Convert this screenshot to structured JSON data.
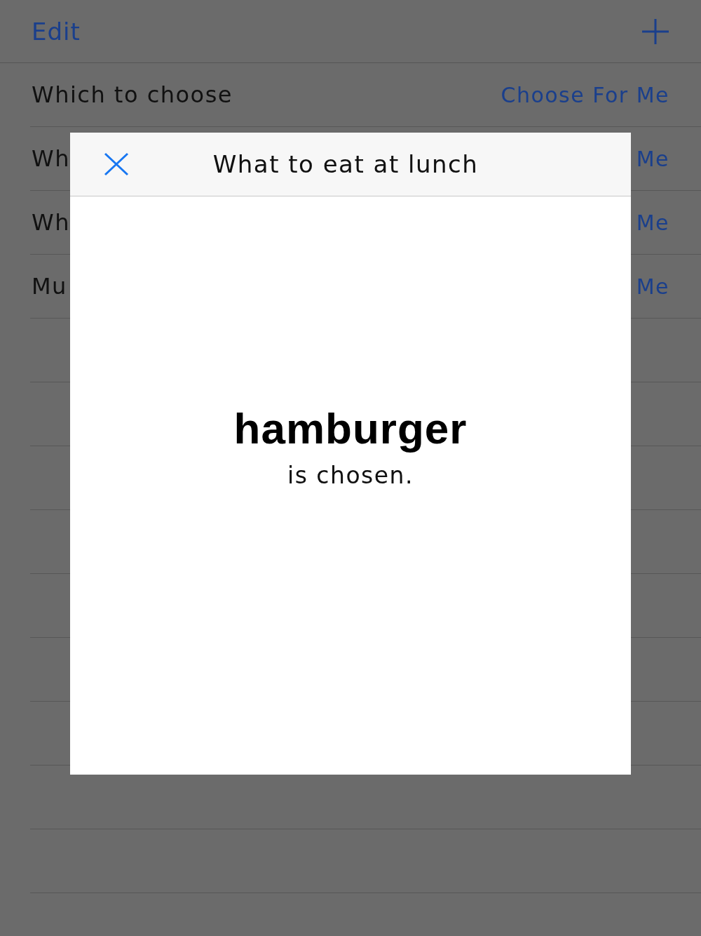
{
  "nav": {
    "left_button": "Edit"
  },
  "rows": [
    {
      "title": "Which to choose",
      "action": "Choose For Me"
    },
    {
      "title": "Wh",
      "action": "Me"
    },
    {
      "title": "Wh",
      "action": "Me"
    },
    {
      "title": "Mu",
      "action": "Me"
    }
  ],
  "modal": {
    "title": "What to eat at lunch",
    "result": "hamburger",
    "caption": "is chosen."
  }
}
